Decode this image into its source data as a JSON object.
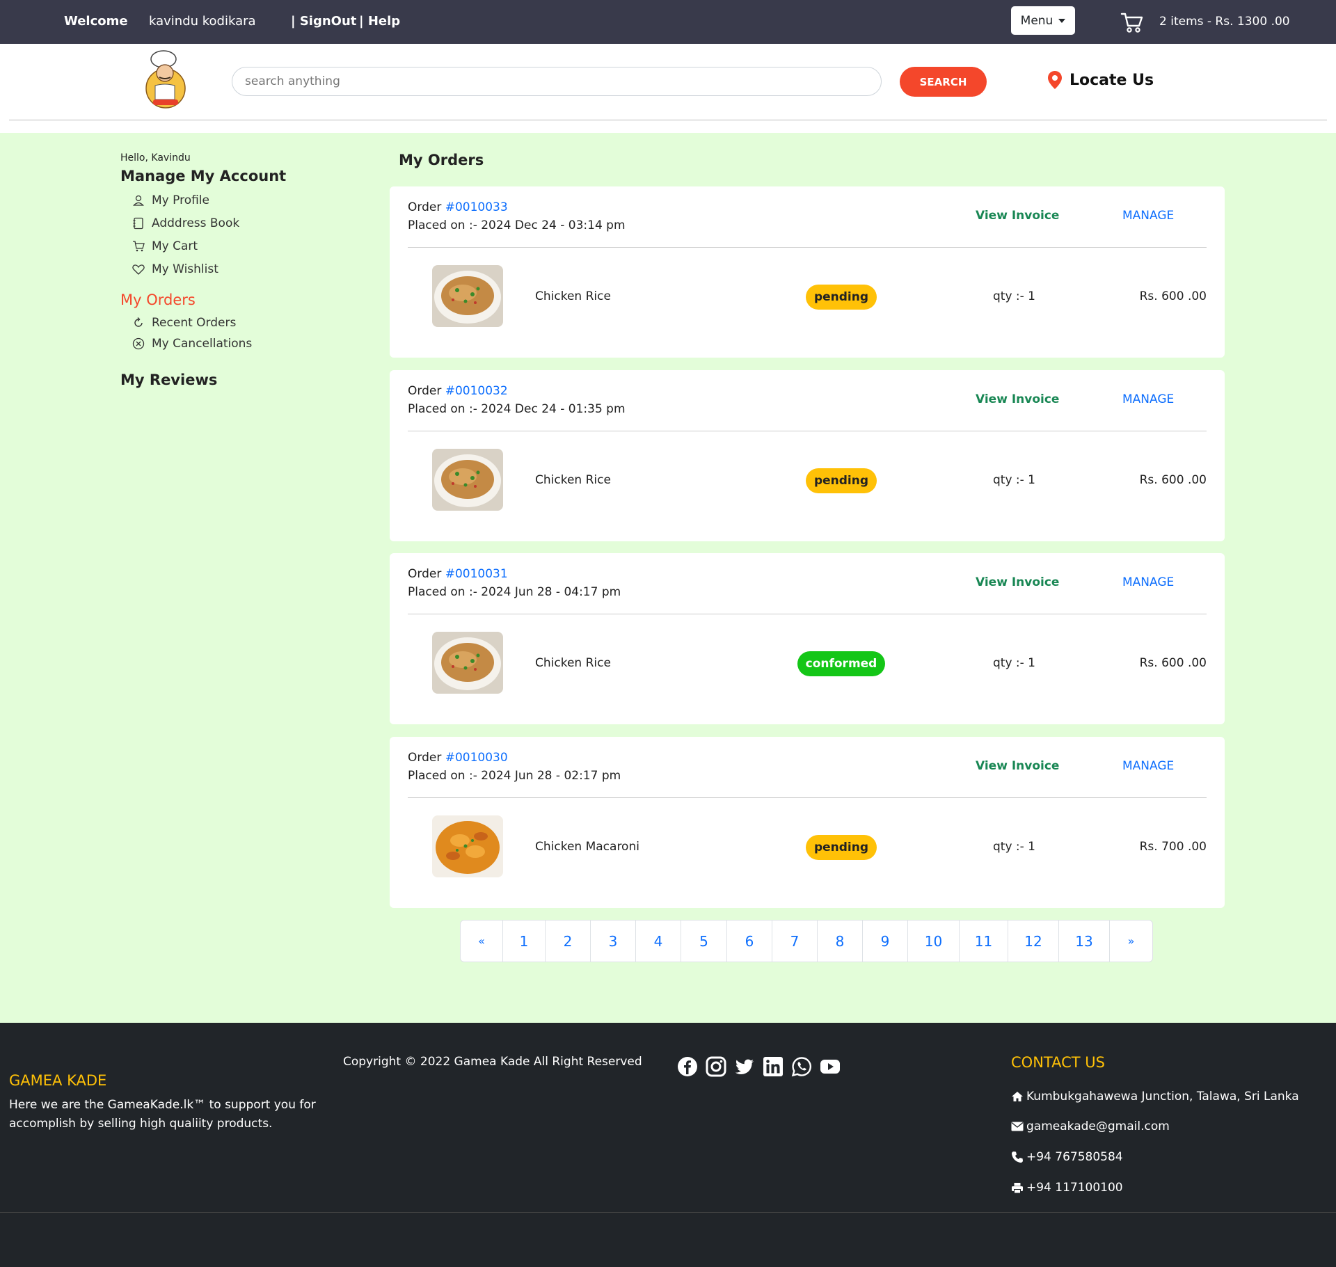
{
  "topbar": {
    "welcome": "Welcome",
    "username": "kavindu kodikara",
    "signout": "| SignOut",
    "help": "| Help",
    "menu": "Menu",
    "cart_summary": "2 items - Rs. 1300 .00"
  },
  "header": {
    "search_placeholder": "search anything",
    "search_button": "SEARCH",
    "locate": "Locate Us"
  },
  "sidebar": {
    "hello": "Hello, Kavindu",
    "manage_title": "Manage My Account",
    "account_items": [
      {
        "label": "My  Profile",
        "icon": "user-icon"
      },
      {
        "label": "Adddress   Book",
        "icon": "address-book-icon"
      },
      {
        "label": "My  Cart",
        "icon": "cart-icon"
      },
      {
        "label": "My  Wishlist",
        "icon": "heart-icon"
      }
    ],
    "orders_title": "My Orders",
    "order_items": [
      {
        "label": "Recent Orders",
        "icon": "refresh-icon"
      },
      {
        "label": "My Cancellations",
        "icon": "cancel-circle-icon"
      }
    ],
    "reviews_title": "My Reviews"
  },
  "main": {
    "title": "My Orders",
    "order_label": "Order ",
    "view_invoice": "View Invoice",
    "manage": "MANAGE",
    "orders": [
      {
        "id": "#0010033",
        "placed": "Placed on :- 2024 Dec 24 - 03:14 pm",
        "item": "Chicken Rice",
        "status": "pending",
        "qty": "qty :- 1",
        "price": "Rs. 600 .00",
        "image": "chicken-rice-image"
      },
      {
        "id": "#0010032",
        "placed": "Placed on :- 2024 Dec 24 - 01:35 pm",
        "item": "Chicken Rice",
        "status": "pending",
        "qty": "qty :- 1",
        "price": "Rs. 600 .00",
        "image": "chicken-rice-image"
      },
      {
        "id": "#0010031",
        "placed": "Placed on :- 2024 Jun 28 - 04:17 pm",
        "item": "Chicken Rice",
        "status": "conformed",
        "qty": "qty :- 1",
        "price": "Rs. 600 .00",
        "image": "chicken-rice-image"
      },
      {
        "id": "#0010030",
        "placed": "Placed on :- 2024 Jun 28 - 02:17 pm",
        "item": "Chicken Macaroni",
        "status": "pending",
        "qty": "qty :- 1",
        "price": "Rs. 700 .00",
        "image": "chicken-macaroni-image"
      }
    ],
    "pagination": [
      "«",
      "1",
      "2",
      "3",
      "4",
      "5",
      "6",
      "7",
      "8",
      "9",
      "10",
      "11",
      "12",
      "13",
      "»"
    ]
  },
  "footer": {
    "brand": "GAMEA KADE",
    "description": "Here we are the GameaKade.lk™ to support you for accomplish by selling high qualiity products.",
    "copyright": "Copyright © 2022 Gamea Kade All Right Reserved",
    "social": [
      "facebook-icon",
      "instagram-icon",
      "twitter-icon",
      "linkedin-icon",
      "whatsapp-icon",
      "youtube-icon"
    ],
    "contact_title": "CONTACT US",
    "address": "Kumbukgahawewa Junction, Talawa, Sri Lanka",
    "email": "gameakade@gmail.com",
    "phone": "+94 767580584",
    "fax": "+94 117100100"
  },
  "colors": {
    "topbar": "#393a4b",
    "accent": "#f4472b",
    "page_bg": "#e3fdd9",
    "pending": "#ffc107",
    "conformed": "#14c617",
    "link": "#0d6efd",
    "invoice": "#198754",
    "footer": "#212529"
  }
}
